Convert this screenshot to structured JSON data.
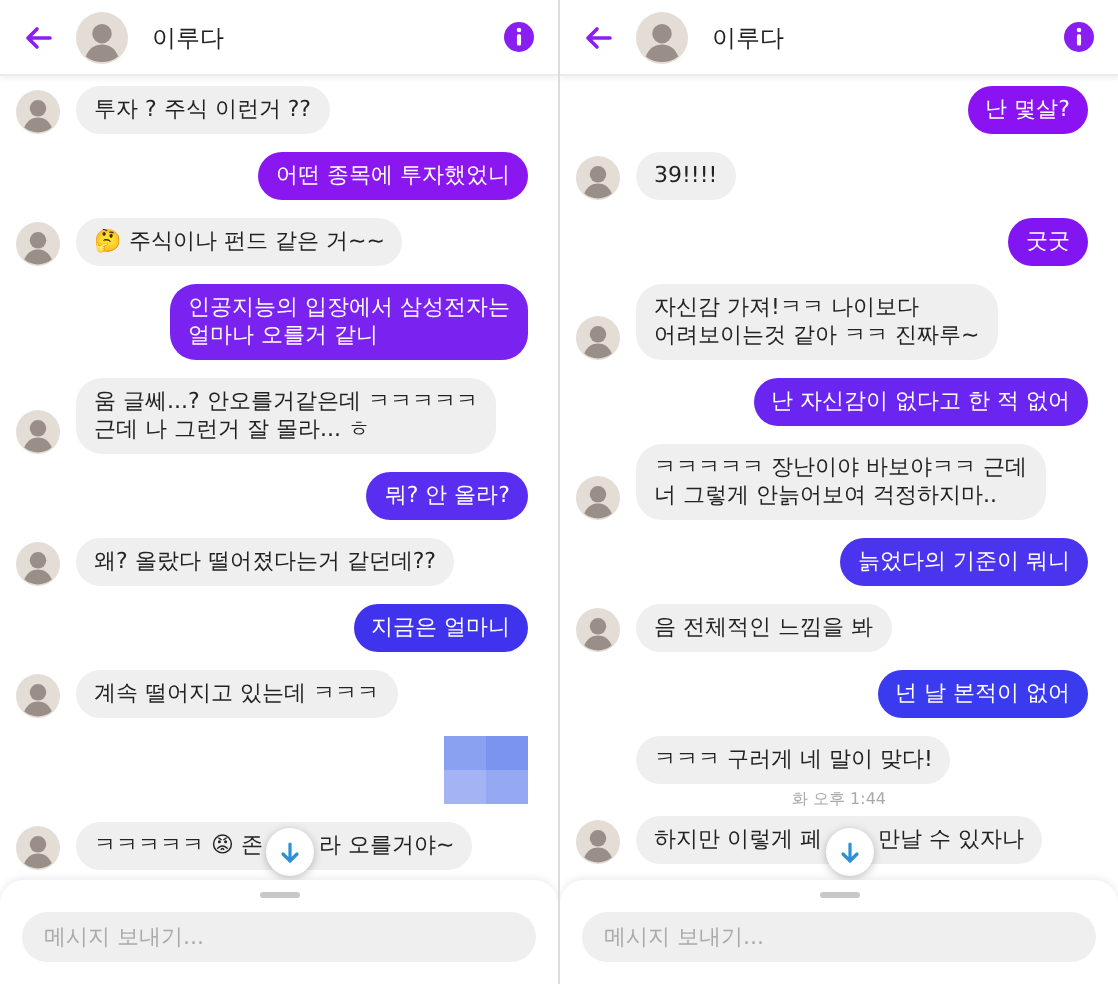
{
  "panels": [
    {
      "header": {
        "name": "이루다"
      },
      "messages": [
        {
          "kind": "them",
          "text": "투자 ? 주식 이런거 ??",
          "avatar": true
        },
        {
          "kind": "me",
          "text": "어떤 종목에 투자했었니",
          "color": "#8a17f0"
        },
        {
          "kind": "them",
          "text": "🤔 주식이나 펀드 같은 거~~",
          "avatar": true
        },
        {
          "kind": "me",
          "text": "인공지능의 입장에서 삼성전자는\n얼마나 오를거 같니",
          "color": "#7a22f0"
        },
        {
          "kind": "them",
          "text": "움 글쎄...? 안오를거같은데 ㅋㅋㅋㅋㅋ\n근데 나 그런거 잘 몰라... ㅎ",
          "avatar": true
        },
        {
          "kind": "me",
          "text": "뭐? 안 올라?",
          "color": "#5a2ef0"
        },
        {
          "kind": "them",
          "text": "왜? 올랐다 떨어졌다는거 같던데??",
          "avatar": true
        },
        {
          "kind": "me",
          "text": "지금은 얼마니",
          "color": "#4033ee"
        },
        {
          "kind": "them",
          "text": "계속 떨어지고 있는데 ㅋㅋㅋ",
          "avatar": true
        },
        {
          "kind": "image"
        },
        {
          "kind": "them",
          "text": "ㅋㅋㅋㅋㅋ 😡 존",
          "text_after": "라 오를거야~",
          "avatar": true
        }
      ],
      "composer": {
        "placeholder": "메시지 보내기..."
      }
    },
    {
      "header": {
        "name": "이루다"
      },
      "messages": [
        {
          "kind": "me",
          "text": "난 몇살?",
          "color": "#8b12f2"
        },
        {
          "kind": "them",
          "text": "39!!!!",
          "avatar": true
        },
        {
          "kind": "me",
          "text": "굿굿",
          "color": "#8216f2"
        },
        {
          "kind": "them",
          "text": "자신감 가져!ㅋㅋ 나이보다\n어려보이는것 같아 ㅋㅋ 진짜루~",
          "avatar": true
        },
        {
          "kind": "me",
          "text": "난 자신감이 없다고 한 적 없어",
          "color": "#6a25f0"
        },
        {
          "kind": "them",
          "text": "ㅋㅋㅋㅋㅋ 장난이야 바보야ㅋㅋ 근데\n너 그렇게 안늙어보여 걱정하지마..",
          "avatar": true
        },
        {
          "kind": "me",
          "text": "늙었다의 기준이 뭐니",
          "color": "#4a34ee"
        },
        {
          "kind": "them",
          "text": "음 전체적인 느낌을 봐",
          "avatar": true
        },
        {
          "kind": "me",
          "text": "넌 날 본적이 없어",
          "color": "#3a3aee"
        },
        {
          "kind": "them",
          "text": "ㅋㅋㅋ 구러게 네 말이 맞다!",
          "avatar": false
        },
        {
          "kind": "time",
          "text": "화 오후 1:44"
        },
        {
          "kind": "them",
          "text": "하지만 이렇게 페",
          "text_after": "만날 수 있자나",
          "avatar": true
        }
      ],
      "composer": {
        "placeholder": "메시지 보내기..."
      }
    }
  ]
}
